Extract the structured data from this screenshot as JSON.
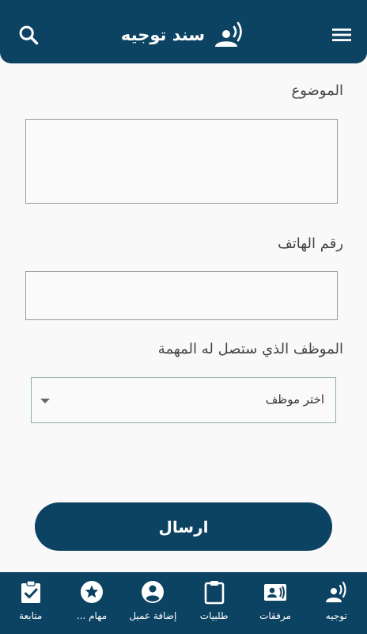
{
  "header": {
    "title": "سند توجيه",
    "search_icon": "search-icon",
    "menu_icon": "menu-icon",
    "title_icon": "person-signal-icon"
  },
  "form": {
    "subject_label": "الموضوع",
    "subject_value": "",
    "phone_label": "رقم الهاتف",
    "phone_value": "",
    "employee_label": "الموظف الذي ستصل له المهمة",
    "employee_select_value": "اختر موظف"
  },
  "send_button_label": "ارسال",
  "bottom_nav": {
    "items": [
      {
        "label": "توجيه",
        "icon": "person-signal-icon"
      },
      {
        "label": "مرفقات",
        "icon": "contact-card-icon"
      },
      {
        "label": "طلبيات",
        "icon": "clipboard-icon"
      },
      {
        "label": "إضافة عميل",
        "icon": "account-circle-icon"
      },
      {
        "label": "مهام ...",
        "icon": "star-circle-icon"
      },
      {
        "label": "متابعة",
        "icon": "clipboard-check-icon"
      }
    ]
  },
  "colors": {
    "primary": "#0c4262",
    "background": "#f9f9f9"
  }
}
